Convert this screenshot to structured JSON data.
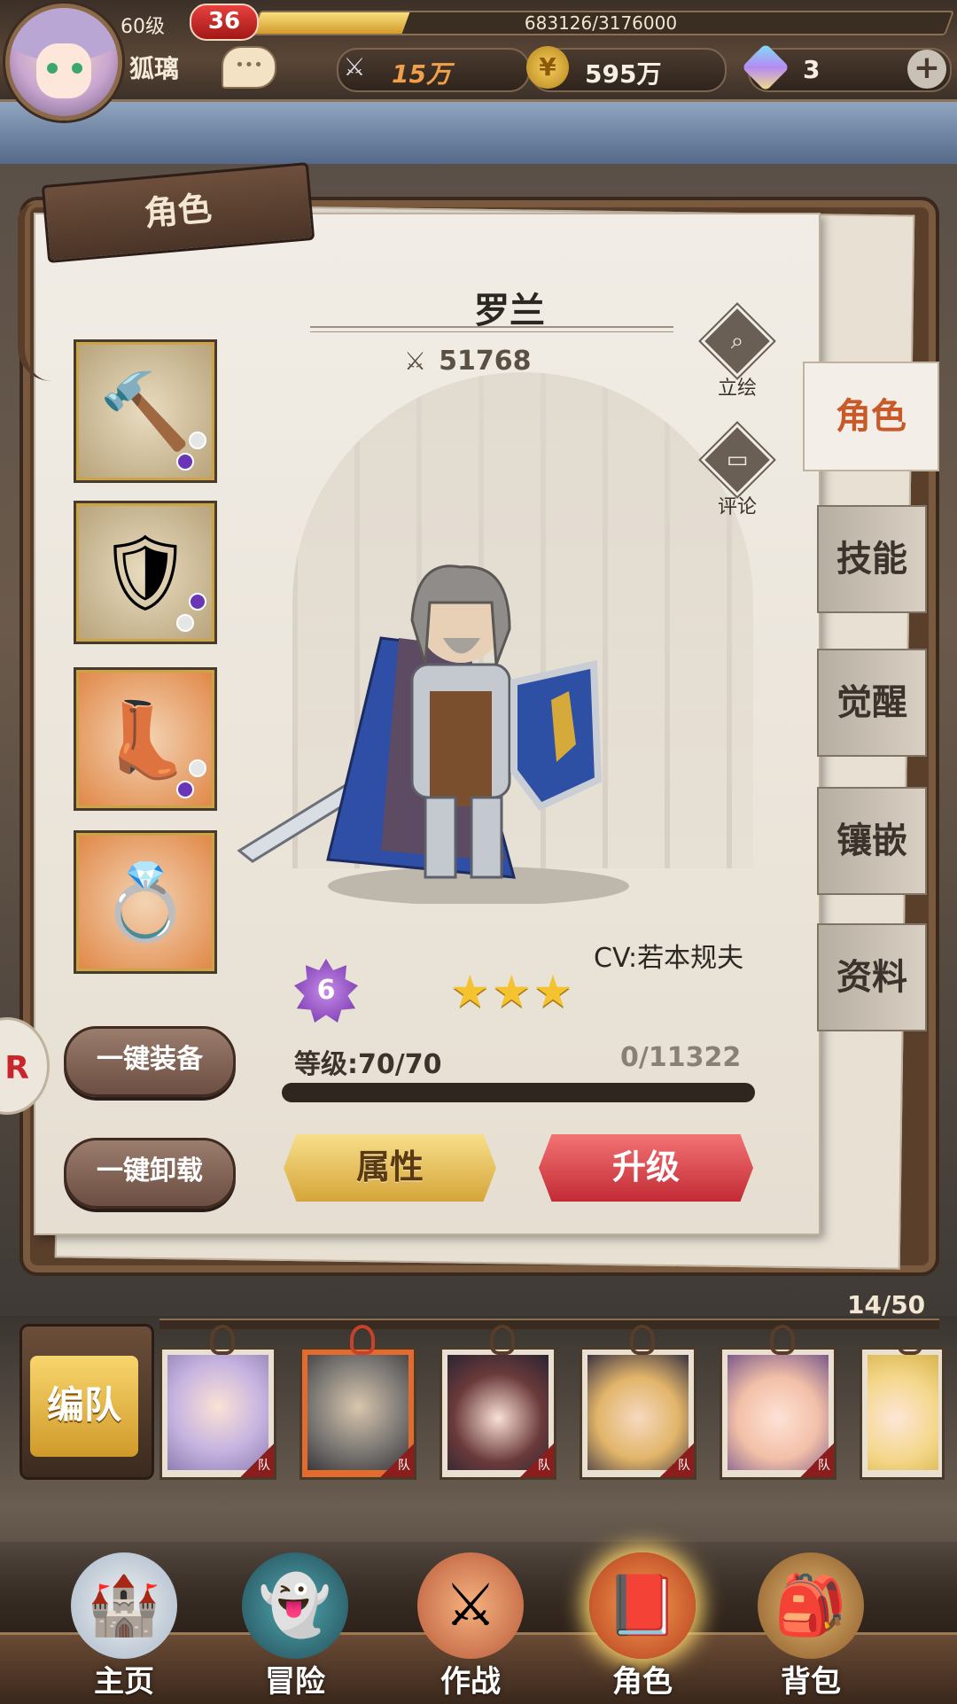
{
  "header": {
    "player_level": "60级",
    "level_badge": "36",
    "exp_text": "683126/3176000",
    "exp_fraction": 0.215,
    "player_name": "狐璃",
    "chat_icon": "chat-bubble-icon",
    "power_value": "15万",
    "coin_value": "595万",
    "gem_value": "3",
    "plus_icon": "+"
  },
  "panel": {
    "title": "角色",
    "hero_name": "罗兰",
    "power_icon": "⚔",
    "power_value": "51768",
    "portrait_btn": "立绘",
    "comment_btn": "评论",
    "cv": "CV:若本规夫",
    "awaken_level": "6",
    "stars": "★★★",
    "star_count": 3,
    "level_label": "等级:70/70",
    "exp_label": "0/11322",
    "exp_fraction": 0,
    "equip_all": "一键装备",
    "unequip_all": "一键卸载",
    "attr_btn": "属性",
    "upgrade_btn": "升级",
    "equipment": [
      {
        "icon": "hammer-icon",
        "glyph": "🔨"
      },
      {
        "icon": "armor-icon",
        "glyph": "🛡"
      },
      {
        "icon": "boots-icon",
        "glyph": "👢"
      },
      {
        "icon": "ring-icon",
        "glyph": "💍"
      }
    ]
  },
  "tabs": {
    "character": "角色",
    "skill": "技能",
    "awaken": "觉醒",
    "inlay": "镶嵌",
    "profile": "资料"
  },
  "roster": {
    "count": "14/50",
    "team_button": "编队",
    "team_flag": "队"
  },
  "nav": {
    "home": "主页",
    "adventure": "冒险",
    "battle": "作战",
    "character": "角色",
    "bag": "背包"
  },
  "colors": {
    "accent_red": "#c22b35",
    "accent_gold": "#d6a53a",
    "active_tab_text": "#c85a2a"
  }
}
